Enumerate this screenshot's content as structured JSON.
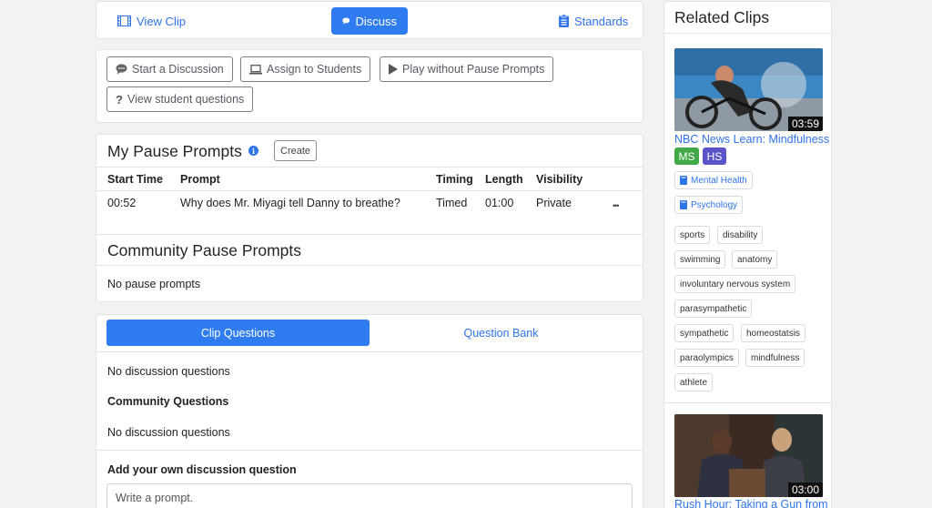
{
  "tabs": {
    "view_clip": "View Clip",
    "discuss": "Discuss",
    "standards": "Standards"
  },
  "actions": {
    "start_discussion": "Start a Discussion",
    "assign_students": "Assign to Students",
    "play_without_prompts": "Play without Pause Prompts",
    "view_student_questions": "View student questions"
  },
  "my_prompts": {
    "title": "My Pause Prompts",
    "create_label": "Create",
    "columns": [
      "Start Time",
      "Prompt",
      "Timing",
      "Length",
      "Visibility"
    ],
    "rows": [
      {
        "start": "00:52",
        "prompt": "Why does Mr. Miyagi tell Danny to breathe?",
        "timing": "Timed",
        "length": "01:00",
        "visibility": "Private",
        "menu": "•••"
      }
    ]
  },
  "community_prompts": {
    "title": "Community Pause Prompts",
    "empty": "No pause prompts"
  },
  "questions": {
    "tab_clip": "Clip Questions",
    "tab_bank": "Question Bank",
    "empty_clip": "No discussion questions",
    "community_heading": "Community Questions",
    "empty_community": "No discussion questions",
    "add_heading": "Add your own discussion question",
    "input_placeholder": "Write a prompt."
  },
  "related": {
    "title": "Related Clips",
    "clips": [
      {
        "title": "NBC News Learn: Mindfulness",
        "duration": "03:59",
        "grades": [
          "MS",
          "HS"
        ],
        "subjects": [
          "Mental Health",
          "Psychology"
        ],
        "tags": [
          "sports",
          "disability",
          "swimming",
          "anatomy",
          "involuntary nervous system",
          "parasympathetic",
          "sympathetic",
          "homeostatsis",
          "paraolympics",
          "mindfulness",
          "athlete"
        ]
      },
      {
        "title": "Rush Hour: Taking a Gun from",
        "duration": "03:00"
      }
    ]
  },
  "colors": {
    "primary": "#2f7bf0",
    "link": "#2f74e8",
    "grade_ms": "#41a947",
    "grade_hs": "#5b54c9"
  }
}
